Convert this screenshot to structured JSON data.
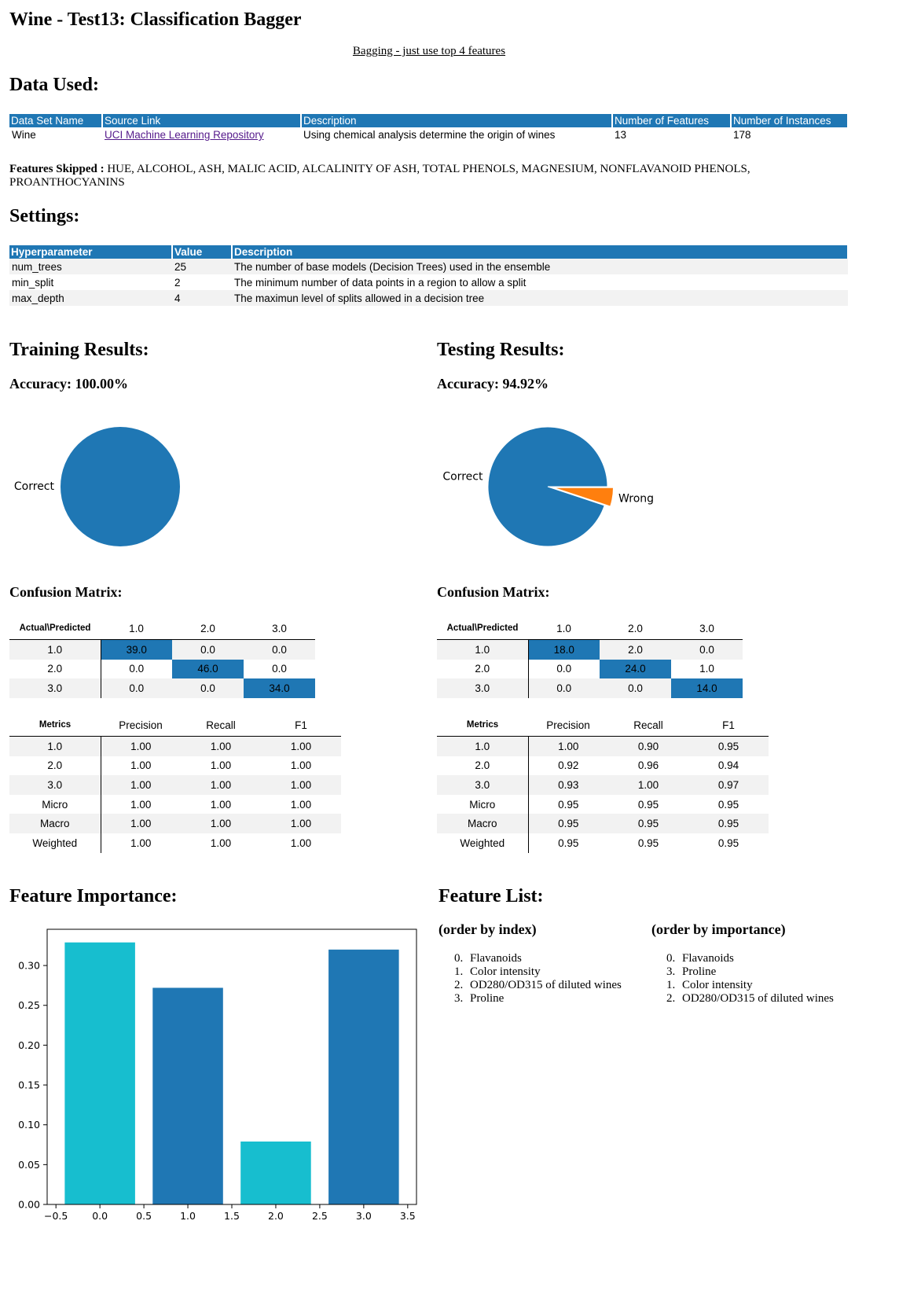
{
  "title": "Wine - Test13: Classification Bagger",
  "subtitle_link": "Bagging - just use top 4 features",
  "data_used": {
    "heading": "Data Used:",
    "headers": [
      "Data Set Name",
      "Source Link",
      "Description",
      "Number of Features",
      "Number of Instances"
    ],
    "row": {
      "name": "Wine",
      "source": "UCI Machine Learning Repository",
      "description": "Using chemical analysis determine the origin of wines",
      "num_features": "13",
      "num_instances": "178"
    }
  },
  "features_skipped": {
    "label": "Features Skipped :",
    "value": "HUE, ALCOHOL, ASH, MALIC ACID, ALCALINITY OF ASH, TOTAL PHENOLS, MAGNESIUM, NONFLAVANOID PHENOLS, PROANTHOCYANINS"
  },
  "settings": {
    "heading": "Settings:",
    "headers": [
      "Hyperparameter",
      "Value",
      "Description"
    ],
    "rows": [
      {
        "name": "num_trees",
        "value": "25",
        "desc": "The number of base models (Decision Trees) used in the ensemble"
      },
      {
        "name": "min_split",
        "value": "2",
        "desc": "The minimum number of data points in a region to allow a split"
      },
      {
        "name": "max_depth",
        "value": "4",
        "desc": "The maximun level of splits allowed in a decision tree"
      }
    ]
  },
  "training": {
    "heading": "Training Results:",
    "accuracy": "Accuracy: 100.00%",
    "confusion_heading": "Confusion Matrix:",
    "confusion": {
      "corner": "Actual\\Predicted",
      "cols": [
        "1.0",
        "2.0",
        "3.0"
      ],
      "rows": [
        {
          "label": "1.0",
          "cells": [
            "39.0",
            "0.0",
            "0.0"
          ]
        },
        {
          "label": "2.0",
          "cells": [
            "0.0",
            "46.0",
            "0.0"
          ]
        },
        {
          "label": "3.0",
          "cells": [
            "0.0",
            "0.0",
            "34.0"
          ]
        }
      ]
    },
    "metrics": {
      "corner": "Metrics",
      "cols": [
        "Precision",
        "Recall",
        "F1"
      ],
      "rows": [
        {
          "label": "1.0",
          "cells": [
            "1.00",
            "1.00",
            "1.00"
          ]
        },
        {
          "label": "2.0",
          "cells": [
            "1.00",
            "1.00",
            "1.00"
          ]
        },
        {
          "label": "3.0",
          "cells": [
            "1.00",
            "1.00",
            "1.00"
          ]
        },
        {
          "label": "Micro",
          "cells": [
            "1.00",
            "1.00",
            "1.00"
          ]
        },
        {
          "label": "Macro",
          "cells": [
            "1.00",
            "1.00",
            "1.00"
          ]
        },
        {
          "label": "Weighted",
          "cells": [
            "1.00",
            "1.00",
            "1.00"
          ]
        }
      ]
    }
  },
  "testing": {
    "heading": "Testing Results:",
    "accuracy": "Accuracy: 94.92%",
    "confusion_heading": "Confusion Matrix:",
    "confusion": {
      "corner": "Actual\\Predicted",
      "cols": [
        "1.0",
        "2.0",
        "3.0"
      ],
      "rows": [
        {
          "label": "1.0",
          "cells": [
            "18.0",
            "2.0",
            "0.0"
          ]
        },
        {
          "label": "2.0",
          "cells": [
            "0.0",
            "24.0",
            "1.0"
          ]
        },
        {
          "label": "3.0",
          "cells": [
            "0.0",
            "0.0",
            "14.0"
          ]
        }
      ]
    },
    "metrics": {
      "corner": "Metrics",
      "cols": [
        "Precision",
        "Recall",
        "F1"
      ],
      "rows": [
        {
          "label": "1.0",
          "cells": [
            "1.00",
            "0.90",
            "0.95"
          ]
        },
        {
          "label": "2.0",
          "cells": [
            "0.92",
            "0.96",
            "0.94"
          ]
        },
        {
          "label": "3.0",
          "cells": [
            "0.93",
            "1.00",
            "0.97"
          ]
        },
        {
          "label": "Micro",
          "cells": [
            "0.95",
            "0.95",
            "0.95"
          ]
        },
        {
          "label": "Macro",
          "cells": [
            "0.95",
            "0.95",
            "0.95"
          ]
        },
        {
          "label": "Weighted",
          "cells": [
            "0.95",
            "0.95",
            "0.95"
          ]
        }
      ]
    }
  },
  "feature_importance_heading": "Feature Importance:",
  "feature_list": {
    "heading": "Feature List:",
    "by_index_heading": "(order by index)",
    "by_importance_heading": "(order by importance)",
    "by_index": [
      {
        "idx": "0.",
        "name": "Flavanoids"
      },
      {
        "idx": "1.",
        "name": "Color intensity"
      },
      {
        "idx": "2.",
        "name": "OD280/OD315 of diluted wines"
      },
      {
        "idx": "3.",
        "name": "Proline"
      }
    ],
    "by_importance": [
      {
        "idx": "0.",
        "name": "Flavanoids"
      },
      {
        "idx": "3.",
        "name": "Proline"
      },
      {
        "idx": "1.",
        "name": "Color intensity"
      },
      {
        "idx": "2.",
        "name": "OD280/OD315 of diluted wines"
      }
    ]
  },
  "colors": {
    "blue": "#1f77b4",
    "orange": "#ff7f0e",
    "cyan": "#17becf",
    "stripe": "#f2f2f2"
  },
  "chart_data": [
    {
      "type": "pie",
      "labels": [
        "Correct"
      ],
      "values": [
        100.0
      ],
      "colors": [
        "#1f77b4"
      ]
    },
    {
      "type": "pie",
      "labels": [
        "Correct",
        "Wrong"
      ],
      "values": [
        94.92,
        5.08
      ],
      "colors": [
        "#1f77b4",
        "#ff7f0e"
      ],
      "explode": [
        0,
        0.1
      ]
    },
    {
      "type": "bar",
      "x": [
        0.0,
        1.0,
        2.0,
        3.0
      ],
      "values": [
        0.329,
        0.272,
        0.079,
        0.32
      ],
      "colors": [
        "#17becf",
        "#1f77b4",
        "#17becf",
        "#1f77b4"
      ],
      "xlim": [
        -0.6,
        3.6
      ],
      "ylim": [
        0,
        0.3455
      ],
      "xticks": [
        "−0.5",
        "0.0",
        "0.5",
        "1.0",
        "1.5",
        "2.0",
        "2.5",
        "3.0",
        "3.5"
      ],
      "yticks": [
        "0.00",
        "0.05",
        "0.10",
        "0.15",
        "0.20",
        "0.25",
        "0.30"
      ],
      "grid": false
    }
  ]
}
